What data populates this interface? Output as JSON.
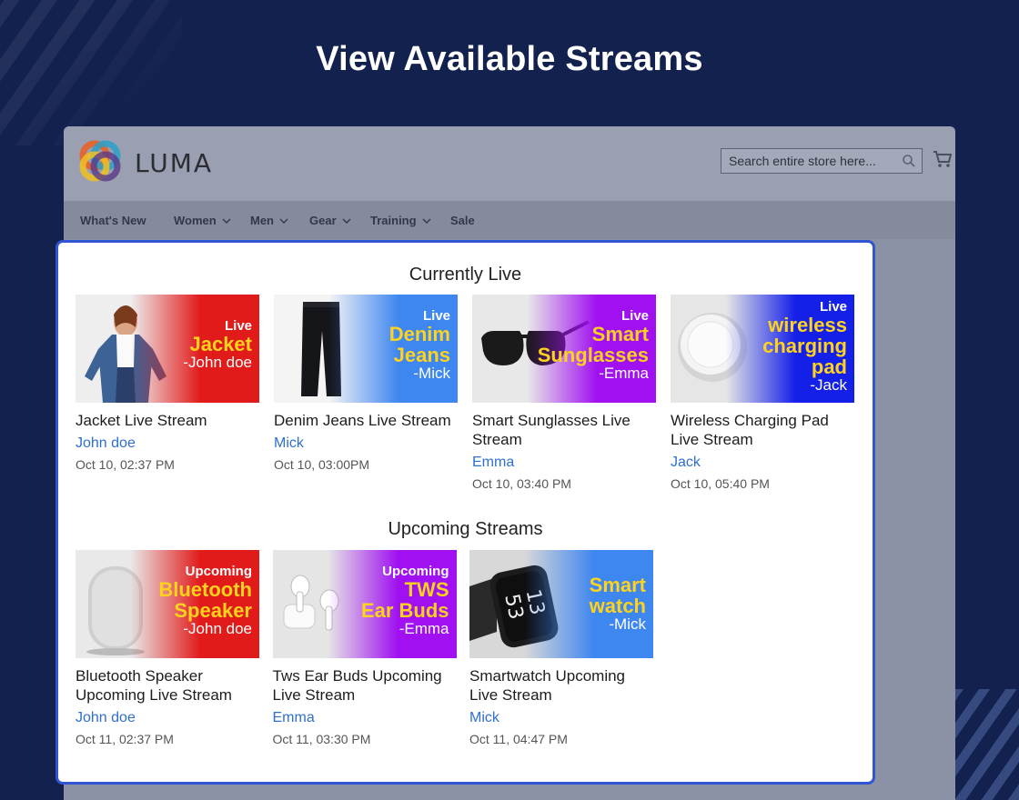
{
  "page": {
    "heading": "View Available Streams"
  },
  "luma": {
    "brand": "LUMA",
    "search_placeholder": "Search entire store here...",
    "nav": [
      {
        "label": "What's New",
        "has_menu": false
      },
      {
        "label": "Women",
        "has_menu": true
      },
      {
        "label": "Men",
        "has_menu": true
      },
      {
        "label": "Gear",
        "has_menu": true
      },
      {
        "label": "Training",
        "has_menu": true
      },
      {
        "label": "Sale",
        "has_menu": false
      }
    ]
  },
  "streams": {
    "live_title": "Currently Live",
    "upcoming_title": "Upcoming Streams",
    "live": [
      {
        "status": "Live",
        "product": [
          "Jacket"
        ],
        "host_tag": "-John doe",
        "title": "Jacket Live Stream",
        "host": "John doe",
        "time": "Oct 10, 02:37 PM",
        "color": "#e11a1a",
        "photo": "jacket"
      },
      {
        "status": "Live",
        "product": [
          "Denim",
          "Jeans"
        ],
        "host_tag": "-Mick",
        "title": "Denim Jeans Live Stream",
        "host": "Mick",
        "time": "Oct 10, 03:00PM",
        "color": "#3e86f0",
        "photo": "jeans"
      },
      {
        "status": "Live",
        "product": [
          "Smart",
          "Sunglasses"
        ],
        "host_tag": "-Emma",
        "title": "Smart Sunglasses Live Stream",
        "host": "Emma",
        "time": "Oct 10, 03:40 PM",
        "color": "#a010f0",
        "photo": "sunglasses"
      },
      {
        "status": "Live",
        "product": [
          "wireless",
          "charging",
          "pad"
        ],
        "host_tag": "-Jack",
        "title": "Wireless Charging Pad Live Stream",
        "host": "Jack",
        "time": "Oct 10, 05:40 PM",
        "color": "#1420e8",
        "photo": "pad"
      }
    ],
    "upcoming": [
      {
        "status": "Upcoming",
        "product": [
          "Bluetooth",
          "Speaker"
        ],
        "host_tag": "-John doe",
        "title": "Bluetooth Speaker Upcoming Live Stream",
        "host": "John doe",
        "time": "Oct 11, 02:37 PM",
        "color": "#e11a1a",
        "photo": "speaker"
      },
      {
        "status": "Upcoming",
        "product": [
          "TWS",
          "Ear Buds"
        ],
        "host_tag": "-Emma",
        "title": "Tws Ear Buds Upcoming Live Stream",
        "host": "Emma",
        "time": "Oct 11, 03:30 PM",
        "color": "#a010f0",
        "photo": "earbuds"
      },
      {
        "status": "",
        "product": [
          "Smart",
          "watch"
        ],
        "host_tag": "-Mick",
        "title": "Smartwatch Upcoming Live Stream",
        "host": "Mick",
        "time": "Oct 11, 04:47 PM",
        "color": "#3e86f0",
        "photo": "watch"
      }
    ]
  }
}
